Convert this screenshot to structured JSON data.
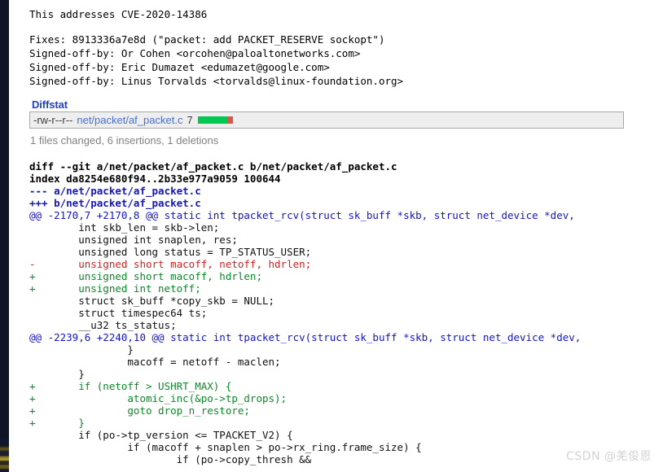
{
  "commit_message": {
    "lines": [
      "This addresses CVE-2020-14386",
      "Fixes: 8913336a7e8d (\"packet: add PACKET_RESERVE sockopt\")",
      "Signed-off-by: Or Cohen <orcohen@paloaltonetworks.com>",
      "Signed-off-by: Eric Dumazet <edumazet@google.com>",
      "Signed-off-by: Linus Torvalds <torvalds@linux-foundation.org>"
    ],
    "cve": "This addresses CVE-2020-14386",
    "fixes": "Fixes: 8913336a7e8d (\"packet: add PACKET_RESERVE sockopt\")",
    "sob1": "Signed-off-by: Or Cohen <orcohen@paloaltonetworks.com>",
    "sob2": "Signed-off-by: Eric Dumazet <edumazet@google.com>",
    "sob3": "Signed-off-by: Linus Torvalds <torvalds@linux-foundation.org>"
  },
  "diffstat": {
    "heading": "Diffstat",
    "mode": "-rw-r--r--",
    "path": "net/packet/af_packet.c",
    "changes": "7",
    "bar_add_color": "#00c853",
    "bar_del_color": "#e2534a",
    "summary": "1 files changed, 6 insertions, 1 deletions"
  },
  "diff": {
    "lines": [
      {
        "kind": "meta",
        "text": "diff --git a/net/packet/af_packet.c b/net/packet/af_packet.c"
      },
      {
        "kind": "meta",
        "text": "index da8254e680f94..2b33e977a9059 100644"
      },
      {
        "kind": "file",
        "text": "--- a/net/packet/af_packet.c"
      },
      {
        "kind": "file",
        "text": "+++ b/net/packet/af_packet.c"
      },
      {
        "kind": "hunk",
        "text": "@@ -2170,7 +2170,8 @@ static int tpacket_rcv(struct sk_buff *skb, struct net_device *dev,"
      },
      {
        "kind": "ctx",
        "text": "        int skb_len = skb->len;"
      },
      {
        "kind": "ctx",
        "text": "        unsigned int snaplen, res;"
      },
      {
        "kind": "ctx",
        "text": "        unsigned long status = TP_STATUS_USER;"
      },
      {
        "kind": "del",
        "text": "-       unsigned short macoff, netoff, hdrlen;"
      },
      {
        "kind": "add",
        "text": "+       unsigned short macoff, hdrlen;"
      },
      {
        "kind": "add",
        "text": "+       unsigned int netoff;"
      },
      {
        "kind": "ctx",
        "text": "        struct sk_buff *copy_skb = NULL;"
      },
      {
        "kind": "ctx",
        "text": "        struct timespec64 ts;"
      },
      {
        "kind": "ctx",
        "text": "        __u32 ts_status;"
      },
      {
        "kind": "hunk",
        "text": "@@ -2239,6 +2240,10 @@ static int tpacket_rcv(struct sk_buff *skb, struct net_device *dev,"
      },
      {
        "kind": "ctx",
        "text": "                }"
      },
      {
        "kind": "ctx",
        "text": "                macoff = netoff - maclen;"
      },
      {
        "kind": "ctx",
        "text": "        }"
      },
      {
        "kind": "add",
        "text": "+       if (netoff > USHRT_MAX) {"
      },
      {
        "kind": "add",
        "text": "+               atomic_inc(&po->tp_drops);"
      },
      {
        "kind": "add",
        "text": "+               goto drop_n_restore;"
      },
      {
        "kind": "add",
        "text": "+       }"
      },
      {
        "kind": "ctx",
        "text": "        if (po->tp_version <= TPACKET_V2) {"
      },
      {
        "kind": "ctx",
        "text": "                if (macoff + snaplen > po->rx_ring.frame_size) {"
      },
      {
        "kind": "ctx",
        "text": "                        if (po->copy_thresh &&"
      }
    ]
  },
  "watermark": {
    "text": "CSDN @羌俊恩"
  }
}
